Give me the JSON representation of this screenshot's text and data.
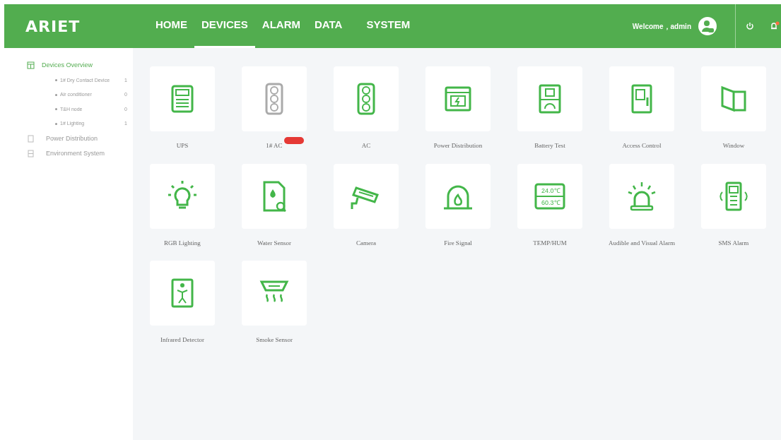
{
  "header": {
    "logo": "ARIET",
    "nav": [
      {
        "label": "HOME",
        "selected": false
      },
      {
        "label": "DEVICES",
        "selected": true
      },
      {
        "label": "ALARM",
        "selected": false
      },
      {
        "label": "DATA",
        "selected": false
      },
      {
        "label": "SYSTEM",
        "selected": false
      }
    ],
    "welcome": "Welcome，admin",
    "notification_dot": true
  },
  "sidebar": {
    "items": [
      {
        "label": "Devices Overview",
        "selected": true,
        "kind": "grid",
        "children": [
          {
            "label": "1# Dry Contact Device",
            "count": "1"
          },
          {
            "label": "Air conditioner",
            "count": "0"
          },
          {
            "label": "T&H node",
            "count": "0"
          },
          {
            "label": "1# Lighting",
            "count": "1"
          }
        ]
      },
      {
        "label": "Power Distribution",
        "selected": false,
        "kind": "box"
      },
      {
        "label": "Environment System",
        "selected": false,
        "kind": "list"
      }
    ]
  },
  "devices": [
    {
      "label": "UPS",
      "kind": "ups",
      "disabled": false,
      "alarm": false
    },
    {
      "label": "1# AC",
      "kind": "ac",
      "disabled": true,
      "alarm": true
    },
    {
      "label": "AC",
      "kind": "ac",
      "disabled": false,
      "alarm": false
    },
    {
      "label": "Power Distribution",
      "kind": "power",
      "disabled": false,
      "alarm": false
    },
    {
      "label": "Battery Test",
      "kind": "battery",
      "disabled": false,
      "alarm": false
    },
    {
      "label": "Access Control",
      "kind": "access",
      "disabled": false,
      "alarm": false
    },
    {
      "label": "Window",
      "kind": "window",
      "disabled": false,
      "alarm": false
    },
    {
      "label": "RGB Lighting",
      "kind": "bulb",
      "disabled": false,
      "alarm": false
    },
    {
      "label": "Water Sensor",
      "kind": "water",
      "disabled": false,
      "alarm": false
    },
    {
      "label": "Camera",
      "kind": "camera",
      "disabled": false,
      "alarm": false
    },
    {
      "label": "Fire Signal",
      "kind": "fire",
      "disabled": false,
      "alarm": false
    },
    {
      "label": "TEMP/HUM",
      "kind": "temphum",
      "disabled": false,
      "alarm": false,
      "readings": [
        "24.0℃",
        "60.3℃"
      ]
    },
    {
      "label": "Audible and Visual Alarm",
      "kind": "siren",
      "disabled": false,
      "alarm": false
    },
    {
      "label": "SMS Alarm",
      "kind": "sms",
      "disabled": false,
      "alarm": false
    },
    {
      "label": "Infrared Detector",
      "kind": "infrared",
      "disabled": false,
      "alarm": false
    },
    {
      "label": "Smoke Sensor",
      "kind": "smoke",
      "disabled": false,
      "alarm": false
    }
  ]
}
